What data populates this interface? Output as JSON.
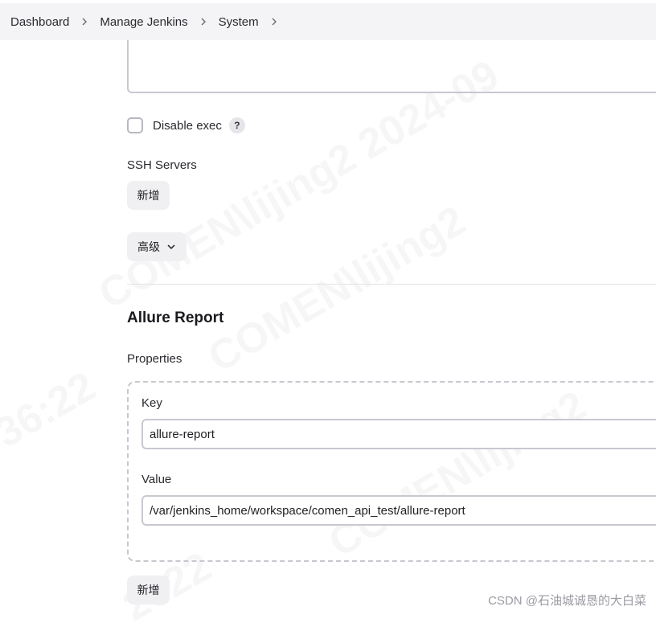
{
  "breadcrumb": {
    "items": [
      "Dashboard",
      "Manage Jenkins",
      "System"
    ]
  },
  "disable_exec": {
    "label": "Disable exec",
    "help": "?",
    "checked": false
  },
  "ssh_servers": {
    "label": "SSH Servers",
    "add_button": "新增",
    "advanced_button": "高级"
  },
  "allure": {
    "title": "Allure Report",
    "properties_label": "Properties",
    "key_label": "Key",
    "key_value": "allure-report",
    "value_label": "Value",
    "value_value": "/var/jenkins_home/workspace/comen_api_test/allure-report",
    "add_button": "新增"
  },
  "watermark": {
    "footer": "CSDN @石油城诚恳的大白菜",
    "overlay": [
      "COMEN\\lijing2 2024-09",
      "COMEN\\lijing2",
      "COMEN\\lijing2",
      "36:22",
      "2022"
    ]
  }
}
